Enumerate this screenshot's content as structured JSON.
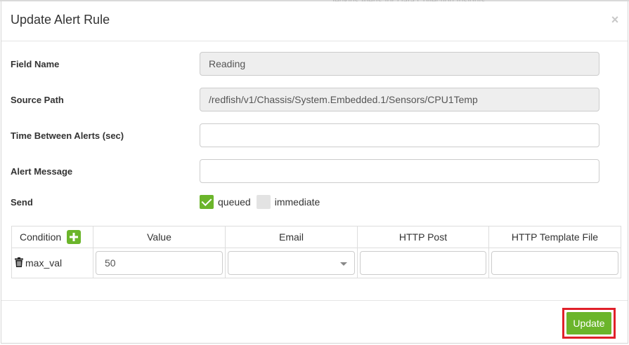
{
  "background": {
    "text": "Jenkins Alerts for Data Collection Insights"
  },
  "modal": {
    "title": "Update Alert Rule",
    "close_glyph": "×"
  },
  "form": {
    "field_name": {
      "label": "Field Name",
      "value": "Reading"
    },
    "source_path": {
      "label": "Source Path",
      "value": "/redfish/v1/Chassis/System.Embedded.1/Sensors/CPU1Temp"
    },
    "time_between_alerts": {
      "label": "Time Between Alerts (sec)",
      "value": ""
    },
    "alert_message": {
      "label": "Alert Message",
      "value": ""
    },
    "send": {
      "label": "Send",
      "options": [
        {
          "label": "queued",
          "checked": true
        },
        {
          "label": "immediate",
          "checked": false
        }
      ]
    }
  },
  "conditions": {
    "headers": [
      "Condition",
      "Value",
      "Email",
      "HTTP Post",
      "HTTP Template File"
    ],
    "rows": [
      {
        "name": "max_val",
        "value": "50",
        "email": "",
        "http_post": "",
        "http_template_file": ""
      }
    ]
  },
  "footer": {
    "update_label": "Update"
  },
  "colors": {
    "accent": "#6bb52b",
    "highlight": "#e0202a"
  },
  "icons": {
    "close": "close-icon",
    "add": "plus-icon",
    "delete": "trash-icon",
    "dropdown": "chevron-down-icon"
  }
}
